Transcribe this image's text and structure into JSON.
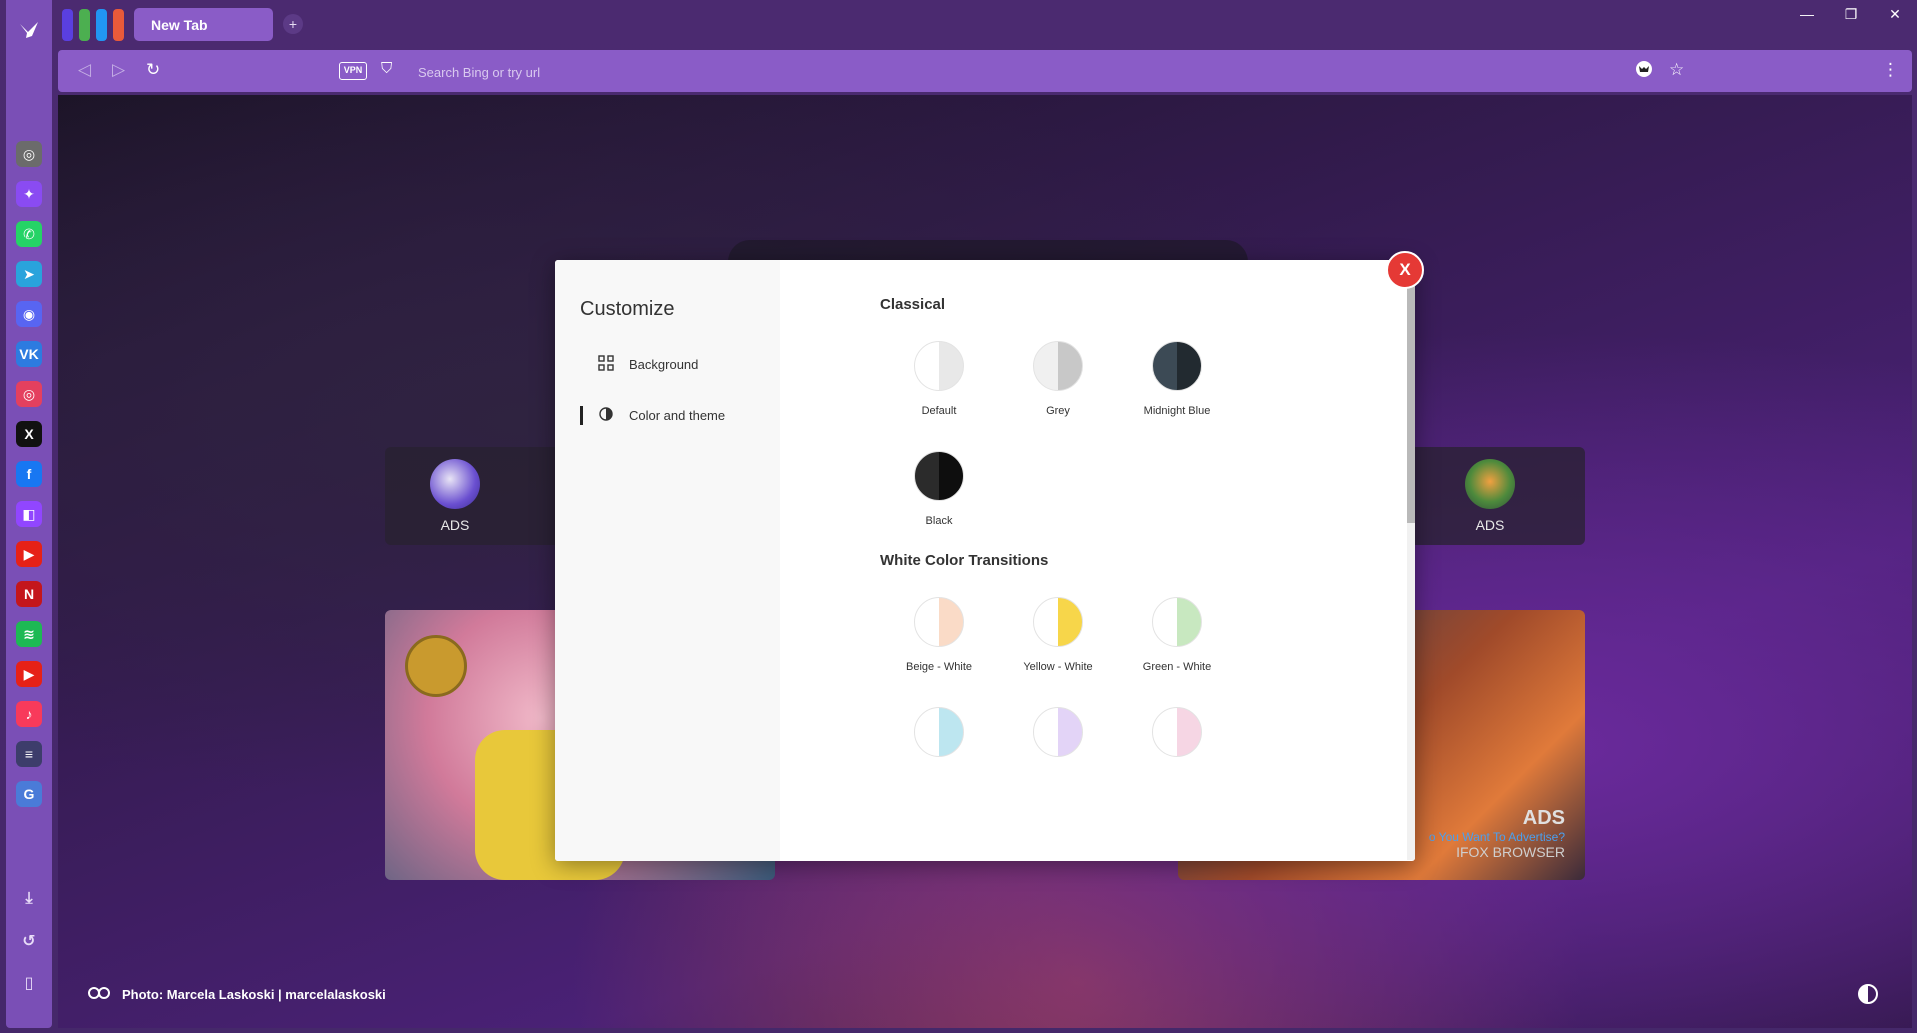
{
  "browser": {
    "tab_title": "New Tab",
    "new_tab_symbol": "+",
    "tab_colors": [
      "#5a3fe0",
      "#4caf50",
      "#2196f3",
      "#e85a3a"
    ],
    "window_controls": {
      "minimize": "—",
      "restore": "❐",
      "close": "✕"
    },
    "vpn_label": "VPN",
    "address_placeholder": "Search Bing or try url",
    "accent": "#8a5cc7"
  },
  "sidebar": {
    "brand_icon": "bird-logo-icon",
    "apps": [
      {
        "name": "chatgpt",
        "glyph": "◎",
        "color": "#6b6b6b"
      },
      {
        "name": "messenger",
        "glyph": "✦",
        "color": "#8a4bf2"
      },
      {
        "name": "whatsapp",
        "glyph": "✆",
        "color": "#25d366"
      },
      {
        "name": "telegram",
        "glyph": "➤",
        "color": "#2aa3dc"
      },
      {
        "name": "discord",
        "glyph": "◉",
        "color": "#5865f2"
      },
      {
        "name": "vk",
        "glyph": "VK",
        "color": "#2d7be0"
      },
      {
        "name": "instagram",
        "glyph": "◎",
        "color": "#e4405f"
      },
      {
        "name": "x",
        "glyph": "X",
        "color": "#111111"
      },
      {
        "name": "facebook",
        "glyph": "f",
        "color": "#1877f2"
      },
      {
        "name": "twitch",
        "glyph": "◧",
        "color": "#9146ff"
      },
      {
        "name": "youtube",
        "glyph": "▶",
        "color": "#e62117"
      },
      {
        "name": "netflix",
        "glyph": "N",
        "color": "#c4161c"
      },
      {
        "name": "spotify",
        "glyph": "≋",
        "color": "#1db954"
      },
      {
        "name": "youtube-music",
        "glyph": "▶",
        "color": "#e62117"
      },
      {
        "name": "apple-music",
        "glyph": "♪",
        "color": "#f83a5b"
      },
      {
        "name": "deezer",
        "glyph": "≡",
        "color": "#3d3d6b"
      },
      {
        "name": "translate",
        "glyph": "G",
        "color": "#4a7bd8"
      }
    ],
    "bottom": [
      {
        "name": "downloads",
        "glyph": "⤓"
      },
      {
        "name": "history",
        "glyph": "↺"
      },
      {
        "name": "bookmarks",
        "glyph": "▯"
      }
    ]
  },
  "newtab": {
    "ads_label_left": "ADS",
    "ads_label_right": "ADS",
    "banner_ads": "ADS",
    "banner_question": "o You Want To Advertise?",
    "banner_brand": "IFOX BROWSER",
    "photo_credit": "Photo: Marcela Laskoski | marcelalaskoski"
  },
  "customize": {
    "title": "Customize",
    "menu": [
      {
        "label": "Background",
        "icon": "grid-icon"
      },
      {
        "label": "Color and theme",
        "icon": "contrast-icon"
      }
    ],
    "active_menu": "Color and theme",
    "close_label": "X",
    "sections": [
      {
        "title": "Classical",
        "swatches": [
          {
            "label": "Default",
            "left": "#ffffff",
            "right": "#e8e8e8"
          },
          {
            "label": "Grey",
            "left": "#f0f0f0",
            "right": "#c8c8c8"
          },
          {
            "label": "Midnight Blue",
            "left": "#3c4a55",
            "right": "#222a30"
          },
          {
            "label": "Black",
            "left": "#2b2b2b",
            "right": "#0e0e0e"
          }
        ]
      },
      {
        "title": "White Color Transitions",
        "swatches": [
          {
            "label": "Beige - White",
            "left": "#ffffff",
            "right": "#fadbc7"
          },
          {
            "label": "Yellow - White",
            "left": "#ffffff",
            "right": "#f7d64a"
          },
          {
            "label": "Green - White",
            "left": "#ffffff",
            "right": "#c8e8c0"
          },
          {
            "label": "",
            "left": "#ffffff",
            "right": "#bde6f0"
          },
          {
            "label": "",
            "left": "#ffffff",
            "right": "#e3d4f7"
          },
          {
            "label": "",
            "left": "#ffffff",
            "right": "#f6d6e4"
          }
        ]
      }
    ]
  }
}
